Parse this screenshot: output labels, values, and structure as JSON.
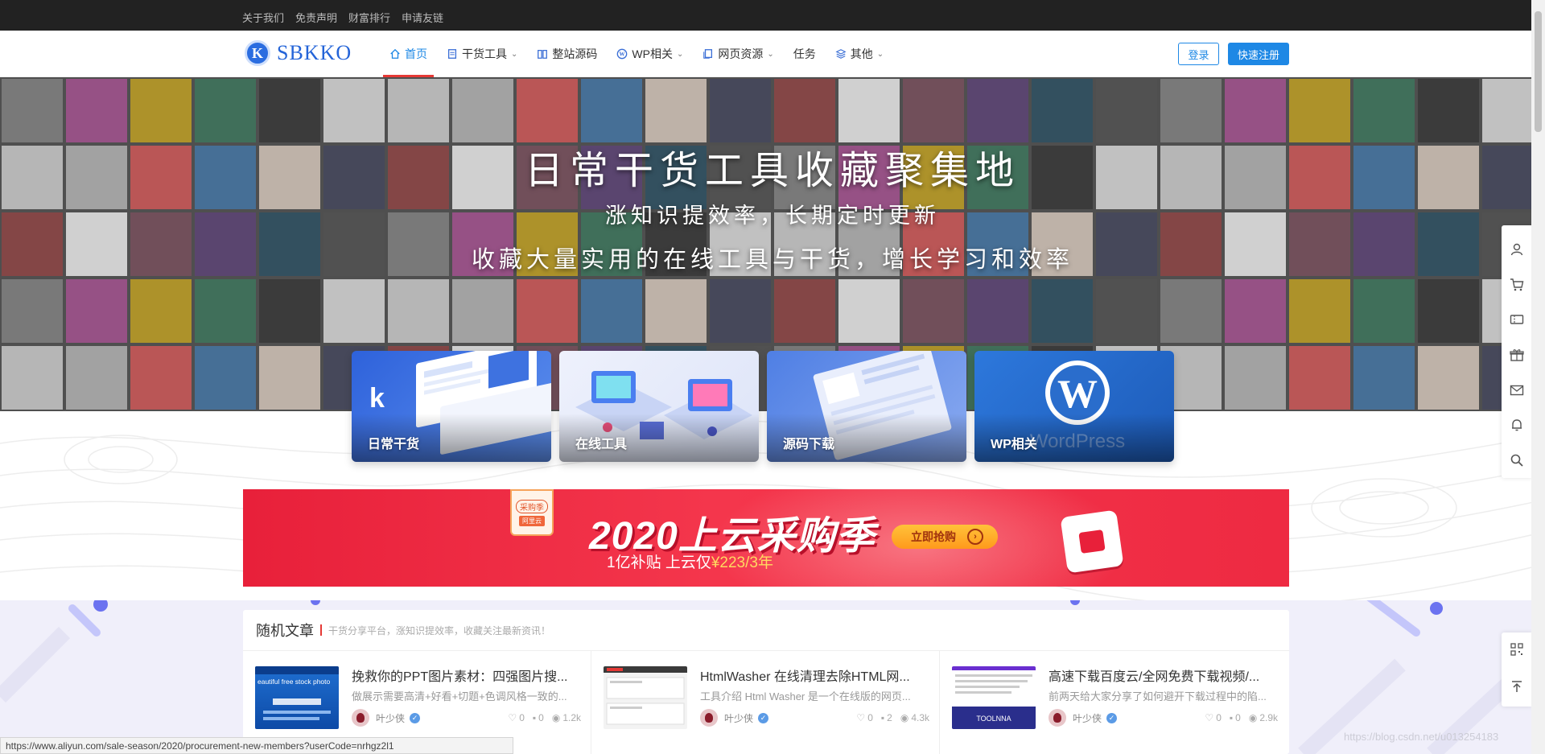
{
  "topbar": {
    "links": [
      "关于我们",
      "免责声明",
      "财富排行",
      "申请友链"
    ]
  },
  "header": {
    "logo_letter": "K",
    "logo_text": "SBKKO",
    "nav": [
      {
        "label": "首页",
        "icon": "home-icon",
        "caret": false,
        "active": true
      },
      {
        "label": "干货工具",
        "icon": "document-icon",
        "caret": true,
        "active": false
      },
      {
        "label": "整站源码",
        "icon": "book-icon",
        "caret": false,
        "active": false
      },
      {
        "label": "WP相关",
        "icon": "wordpress-icon",
        "caret": true,
        "active": false
      },
      {
        "label": "网页资源",
        "icon": "copy-icon",
        "caret": true,
        "active": false
      },
      {
        "label": "任务",
        "icon": "",
        "caret": false,
        "active": false
      },
      {
        "label": "其他",
        "icon": "layers-icon",
        "caret": true,
        "active": false
      }
    ],
    "login_label": "登录",
    "register_label": "快速注册"
  },
  "hero": {
    "title": "日常干货工具收藏聚集地",
    "subtitle1": "涨知识提效率，长期定时更新",
    "subtitle2": "收藏大量实用的在线工具与干货，增长学习和效率"
  },
  "cards": [
    {
      "label": "日常干货",
      "color": "#3f7ae6"
    },
    {
      "label": "在线工具",
      "color": "#e7ecfb"
    },
    {
      "label": "源码下载",
      "color": "#6f95e8"
    },
    {
      "label": "WP相关",
      "color": "#2e73d8"
    }
  ],
  "ad": {
    "badge_top": "采购季",
    "badge_brand": "阿里云",
    "title": "2020上云采购季",
    "subtitle_prefix": "1亿补贴 上云仅",
    "subtitle_price": "¥223/3年",
    "button": "立即抢购"
  },
  "articles": {
    "title": "随机文章",
    "description": "干货分享平台，涨知识提效率，收藏关注最新资讯！",
    "items": [
      {
        "title": "挽救你的PPT图片素材：四强图片搜...",
        "desc": "做展示需要高清+好看+切题+色调风格一致的...",
        "author": "叶少侠",
        "likes": "0",
        "comments": "0",
        "views": "1.2k"
      },
      {
        "title": "HtmlWasher 在线清理去除HTML网...",
        "desc": "工具介绍 Html Washer 是一个在线版的网页...",
        "author": "叶少侠",
        "likes": "0",
        "comments": "2",
        "views": "4.3k"
      },
      {
        "title": "高速下载百度云/全网免费下载视频/...",
        "desc": "前两天给大家分享了如何避开下载过程中的陷...",
        "author": "叶少侠",
        "likes": "0",
        "comments": "0",
        "views": "2.9k"
      }
    ]
  },
  "thumb1_text": "eautiful free stock photo",
  "thumb3_text": "TOOLNNA",
  "float_icons": [
    "user-icon",
    "cart-icon",
    "ticket-icon",
    "gift-icon",
    "mail-icon",
    "bell-icon",
    "search-icon"
  ],
  "float_icons2": [
    "qrcode-icon",
    "back-to-top-icon"
  ],
  "status_url": "https://www.aliyun.com/sale-season/2020/procurement-new-members?userCode=nrhgz2l1",
  "watermark": "https://blog.csdn.net/u013254183"
}
